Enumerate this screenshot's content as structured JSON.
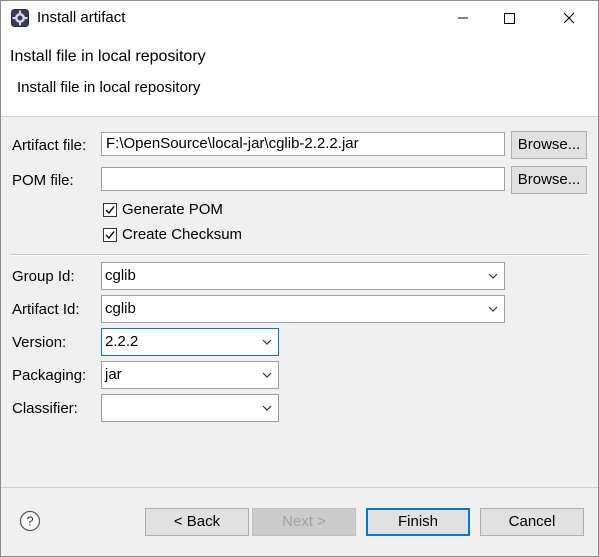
{
  "window": {
    "title": "Install artifact"
  },
  "header": {
    "title": "Install file in local repository",
    "description": "Install file in local repository"
  },
  "form": {
    "artifact_file": {
      "label": "Artifact file:",
      "value": "F:\\OpenSource\\local-jar\\cglib-2.2.2.jar",
      "browse_label": "Browse..."
    },
    "pom_file": {
      "label": "POM file:",
      "value": "",
      "browse_label": "Browse..."
    },
    "generate_pom": {
      "label": "Generate POM",
      "checked": true
    },
    "create_checksum": {
      "label": "Create Checksum",
      "checked": true
    },
    "group_id": {
      "label": "Group Id:",
      "value": "cglib"
    },
    "artifact_id": {
      "label": "Artifact Id:",
      "value": "cglib"
    },
    "version": {
      "label": "Version:",
      "value": "2.2.2"
    },
    "packaging": {
      "label": "Packaging:",
      "value": "jar"
    },
    "classifier": {
      "label": "Classifier:",
      "value": ""
    }
  },
  "footer": {
    "back_label": "< Back",
    "next_label": "Next >",
    "finish_label": "Finish",
    "cancel_label": "Cancel"
  },
  "colors": {
    "accent": "#0078d7",
    "panel_bg": "#f0f0f0",
    "button_bg": "#e1e1e1"
  },
  "icons": {
    "app": "eclipse-gear-icon",
    "minimize": "minimize-icon",
    "maximize": "maximize-icon",
    "close": "close-icon",
    "help": "help-icon",
    "dropdown": "chevron-down-icon",
    "check": "checkmark-icon"
  }
}
